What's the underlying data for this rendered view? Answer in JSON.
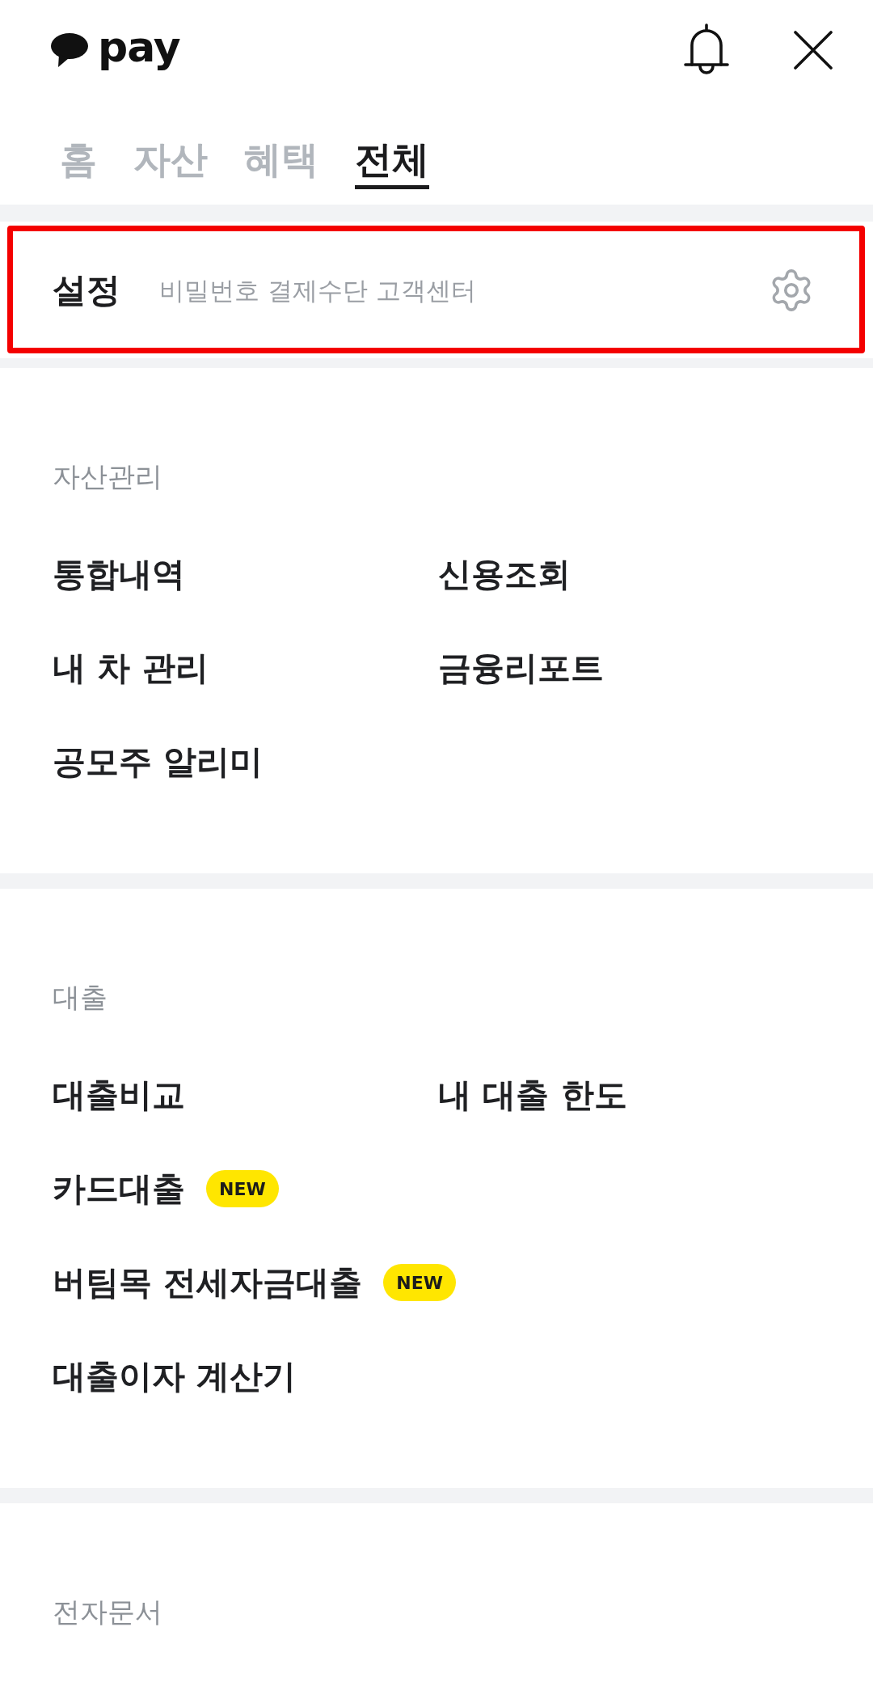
{
  "header": {
    "logo": {
      "text": "pay"
    }
  },
  "tabs": [
    {
      "label": "홈",
      "selected": false
    },
    {
      "label": "자산",
      "selected": false
    },
    {
      "label": "혜택",
      "selected": false
    },
    {
      "label": "전체",
      "selected": true
    }
  ],
  "settings": {
    "title": "설정",
    "subtitle": "비밀번호 결제수단 고객센터",
    "highlighted": true
  },
  "sections": [
    {
      "title": "자산관리",
      "rows": [
        [
          {
            "label": "통합내역"
          },
          {
            "label": "신용조회"
          }
        ],
        [
          {
            "label": "내 차 관리"
          },
          {
            "label": "금융리포트"
          }
        ],
        [
          {
            "label": "공모주 알리미"
          }
        ]
      ]
    },
    {
      "title": "대출",
      "rows": [
        [
          {
            "label": "대출비교"
          },
          {
            "label": "내 대출 한도"
          }
        ],
        [
          {
            "label": "카드대출",
            "badge": "NEW"
          }
        ],
        [
          {
            "label": "버팀목 전세자금대출",
            "badge": "NEW"
          }
        ],
        [
          {
            "label": "대출이자 계산기"
          }
        ]
      ]
    },
    {
      "title": "전자문서"
    }
  ]
}
